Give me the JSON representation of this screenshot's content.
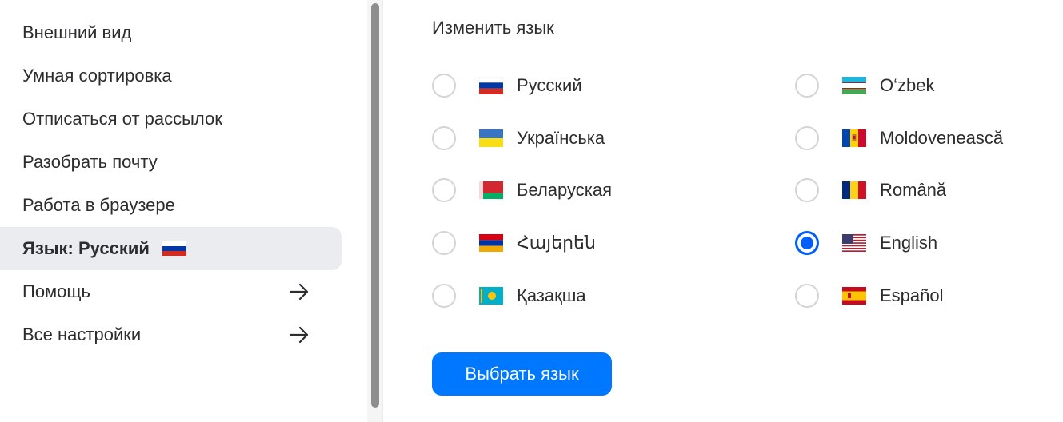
{
  "sidebar": {
    "items": [
      {
        "label": "Внешний вид"
      },
      {
        "label": "Умная сортировка"
      },
      {
        "label": "Отписаться от рассылок"
      },
      {
        "label": "Разобрать почту"
      },
      {
        "label": "Работа в браузере"
      },
      {
        "label": "Язык: Русский",
        "active": true,
        "icon": "flag-ru-icon"
      },
      {
        "label": "Помощь",
        "icon": "arrow-right-icon"
      },
      {
        "label": "Все настройки",
        "icon": "arrow-right-icon"
      }
    ]
  },
  "main": {
    "title": "Изменить язык",
    "languages": [
      {
        "label": "Русский",
        "flag": "flag-ru-icon",
        "selected": false
      },
      {
        "label": "Українська",
        "flag": "flag-ua-icon",
        "selected": false
      },
      {
        "label": "Беларуская",
        "flag": "flag-by-icon",
        "selected": false
      },
      {
        "label": "Հայերեն",
        "flag": "flag-am-icon",
        "selected": false
      },
      {
        "label": "Қазақша",
        "flag": "flag-kz-icon",
        "selected": false
      },
      {
        "label": "O‘zbek",
        "flag": "flag-uz-icon",
        "selected": false
      },
      {
        "label": "Moldovenească",
        "flag": "flag-md-icon",
        "selected": false
      },
      {
        "label": "Română",
        "flag": "flag-ro-icon",
        "selected": false
      },
      {
        "label": "English",
        "flag": "flag-us-icon",
        "selected": true
      },
      {
        "label": "Español",
        "flag": "flag-es-icon",
        "selected": false
      }
    ],
    "submit_label": "Выбрать язык"
  },
  "colors": {
    "accent": "#0077ff",
    "radio_checked": "#005ff9",
    "active_item_bg": "#ebecef",
    "text": "#2c2d2e"
  }
}
